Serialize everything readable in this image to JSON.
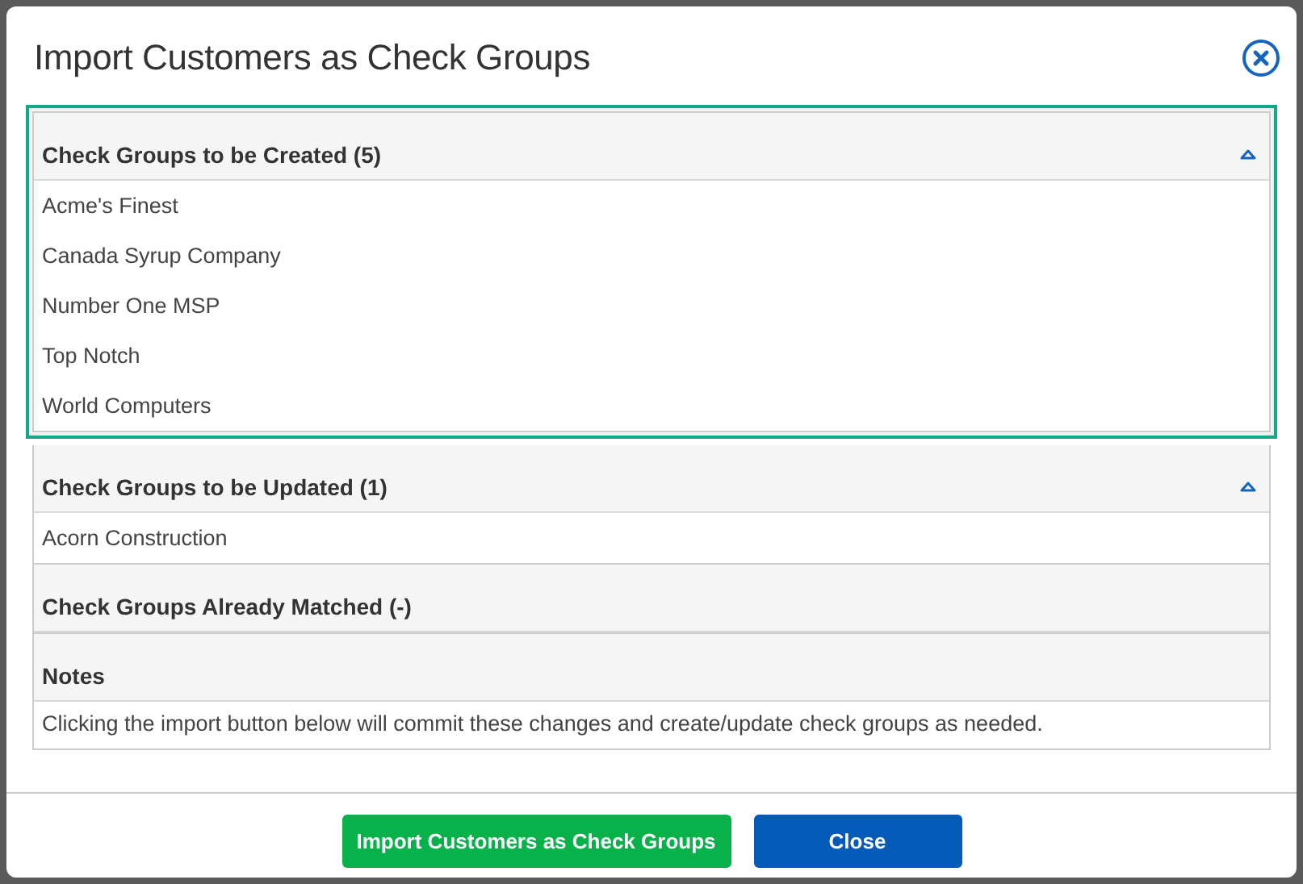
{
  "dialog": {
    "title": "Import Customers as Check Groups"
  },
  "sections": [
    {
      "kind": "list",
      "title": "Check Groups to be Created (5)",
      "expanded": true,
      "highlighted": true,
      "items": [
        "Acme's Finest",
        "Canada Syrup Company",
        "Number One MSP",
        "Top Notch",
        "World Computers"
      ]
    },
    {
      "kind": "list",
      "title": "Check Groups to be Updated (1)",
      "expanded": true,
      "highlighted": false,
      "items": [
        "Acorn Construction"
      ]
    },
    {
      "kind": "list",
      "title": "Check Groups Already Matched (-)",
      "expanded": false,
      "highlighted": false
    },
    {
      "kind": "notes",
      "title": "Notes",
      "text": "Clicking the import button below will commit these changes and create/update check groups as needed."
    }
  ],
  "buttons": [
    {
      "kind": "primary",
      "label": "Import Customers as Check Groups"
    },
    {
      "kind": "secondary",
      "label": "Close"
    }
  ]
}
